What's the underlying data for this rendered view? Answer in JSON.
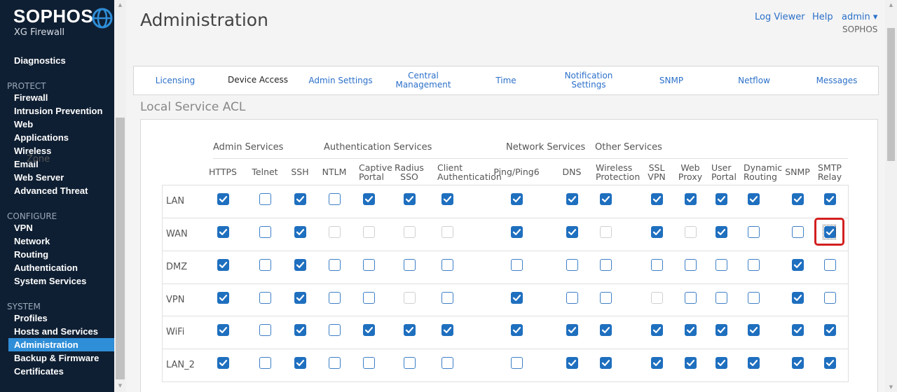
{
  "brand": {
    "name": "SOPHOS",
    "product": "XG Firewall"
  },
  "sidebar": {
    "diagnostics": "Diagnostics",
    "protect": {
      "title": "PROTECT",
      "items": [
        "Firewall",
        "Intrusion Prevention",
        "Web",
        "Applications",
        "Wireless",
        "Email",
        "Web Server",
        "Advanced Threat"
      ]
    },
    "configure": {
      "title": "CONFIGURE",
      "items": [
        "VPN",
        "Network",
        "Routing",
        "Authentication",
        "System Services"
      ]
    },
    "system": {
      "title": "SYSTEM",
      "items": [
        "Profiles",
        "Hosts and Services",
        "Administration",
        "Backup & Firmware",
        "Certificates"
      ]
    },
    "active_item": "Administration"
  },
  "header": {
    "title": "Administration",
    "log_viewer": "Log Viewer",
    "help": "Help",
    "user": "admin ▾",
    "org": "SOPHOS"
  },
  "tabs": [
    {
      "label": "Licensing"
    },
    {
      "label": "Device Access"
    },
    {
      "label": "Admin Settings"
    },
    {
      "label": "Central Management"
    },
    {
      "label": "Time"
    },
    {
      "label": "Notification Settings"
    },
    {
      "label": "SNMP"
    },
    {
      "label": "Netflow"
    },
    {
      "label": "Messages"
    }
  ],
  "active_tab": "Device Access",
  "acl": {
    "title": "Local Service ACL",
    "zone_header": "Zone",
    "groups": [
      "Admin Services",
      "Authentication Services",
      "Network Services",
      "Other Services"
    ],
    "columns": [
      "HTTPS",
      "Telnet",
      "SSH",
      "NTLM",
      "Captive Portal",
      "Radius SSO",
      "Client Authentication",
      "Ping/Ping6",
      "DNS",
      "Wireless Protection",
      "SSL VPN",
      "Web Proxy",
      "User Portal",
      "Dynamic Routing",
      "SNMP",
      "SMTP Relay"
    ],
    "rows": [
      {
        "zone": "LAN",
        "states": [
          "c",
          "u",
          "c",
          "u",
          "c",
          "c",
          "c",
          "c",
          "c",
          "c",
          "c",
          "c",
          "c",
          "c",
          "c",
          "c"
        ]
      },
      {
        "zone": "WAN",
        "states": [
          "c",
          "u",
          "c",
          "d",
          "d",
          "d",
          "d",
          "c",
          "c",
          "d",
          "c",
          "d",
          "c",
          "u",
          "u",
          "c"
        ]
      },
      {
        "zone": "DMZ",
        "states": [
          "c",
          "u",
          "c",
          "u",
          "u",
          "u",
          "u",
          "u",
          "u",
          "u",
          "u",
          "u",
          "u",
          "u",
          "c",
          "u"
        ]
      },
      {
        "zone": "VPN",
        "states": [
          "c",
          "u",
          "c",
          "u",
          "u",
          "d",
          "u",
          "c",
          "u",
          "u",
          "d",
          "u",
          "u",
          "u",
          "c",
          "u"
        ]
      },
      {
        "zone": "WiFi",
        "states": [
          "c",
          "u",
          "c",
          "u",
          "c",
          "c",
          "c",
          "c",
          "c",
          "c",
          "c",
          "c",
          "c",
          "c",
          "c",
          "c"
        ]
      },
      {
        "zone": "LAN_2",
        "states": [
          "c",
          "u",
          "c",
          "u",
          "u",
          "u",
          "u",
          "u",
          "c",
          "c",
          "c",
          "c",
          "c",
          "c",
          "c",
          "c"
        ]
      }
    ],
    "legend": {
      "c": "checked",
      "u": "unchecked",
      "d": "disabled"
    }
  },
  "colors": {
    "sidebar_bg": "#0f1f33",
    "accent": "#1f6fbf",
    "active_nav": "#2f8ed8",
    "highlight": "#d32020"
  }
}
